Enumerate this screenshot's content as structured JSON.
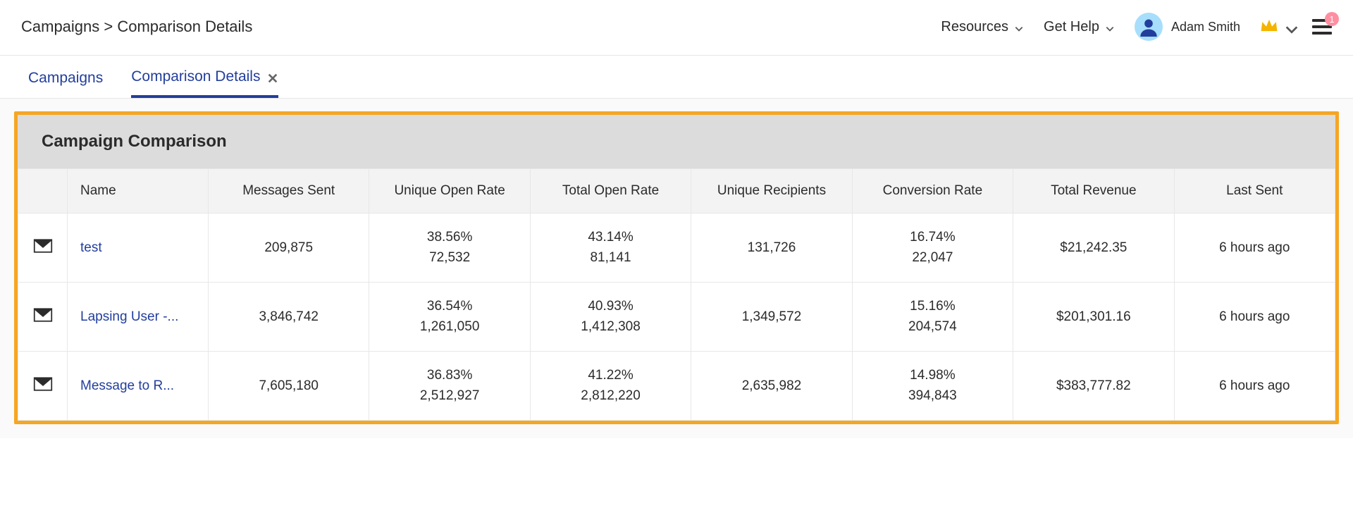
{
  "breadcrumb": "Campaigns > Comparison Details",
  "topbar": {
    "resources": "Resources",
    "get_help": "Get Help",
    "user_name": "Adam Smith",
    "notifications_count": "1"
  },
  "tabs": {
    "campaigns": "Campaigns",
    "comparison_details": "Comparison Details"
  },
  "panel_title": "Campaign Comparison",
  "columns": {
    "name": "Name",
    "messages_sent": "Messages Sent",
    "unique_open_rate": "Unique Open Rate",
    "total_open_rate": "Total Open Rate",
    "unique_recipients": "Unique Recipients",
    "conversion_rate": "Conversion Rate",
    "total_revenue": "Total Revenue",
    "last_sent": "Last Sent"
  },
  "rows": [
    {
      "name": "test",
      "messages_sent": "209,875",
      "unique_open_rate_pct": "38.56%",
      "unique_open_rate_num": "72,532",
      "total_open_rate_pct": "43.14%",
      "total_open_rate_num": "81,141",
      "unique_recipients": "131,726",
      "conversion_rate_pct": "16.74%",
      "conversion_rate_num": "22,047",
      "total_revenue": "$21,242.35",
      "last_sent": "6 hours ago"
    },
    {
      "name": "Lapsing User -...",
      "messages_sent": "3,846,742",
      "unique_open_rate_pct": "36.54%",
      "unique_open_rate_num": "1,261,050",
      "total_open_rate_pct": "40.93%",
      "total_open_rate_num": "1,412,308",
      "unique_recipients": "1,349,572",
      "conversion_rate_pct": "15.16%",
      "conversion_rate_num": "204,574",
      "total_revenue": "$201,301.16",
      "last_sent": "6 hours ago"
    },
    {
      "name": "Message to R...",
      "messages_sent": "7,605,180",
      "unique_open_rate_pct": "36.83%",
      "unique_open_rate_num": "2,512,927",
      "total_open_rate_pct": "41.22%",
      "total_open_rate_num": "2,812,220",
      "unique_recipients": "2,635,982",
      "conversion_rate_pct": "14.98%",
      "conversion_rate_num": "394,843",
      "total_revenue": "$383,777.82",
      "last_sent": "6 hours ago"
    }
  ]
}
